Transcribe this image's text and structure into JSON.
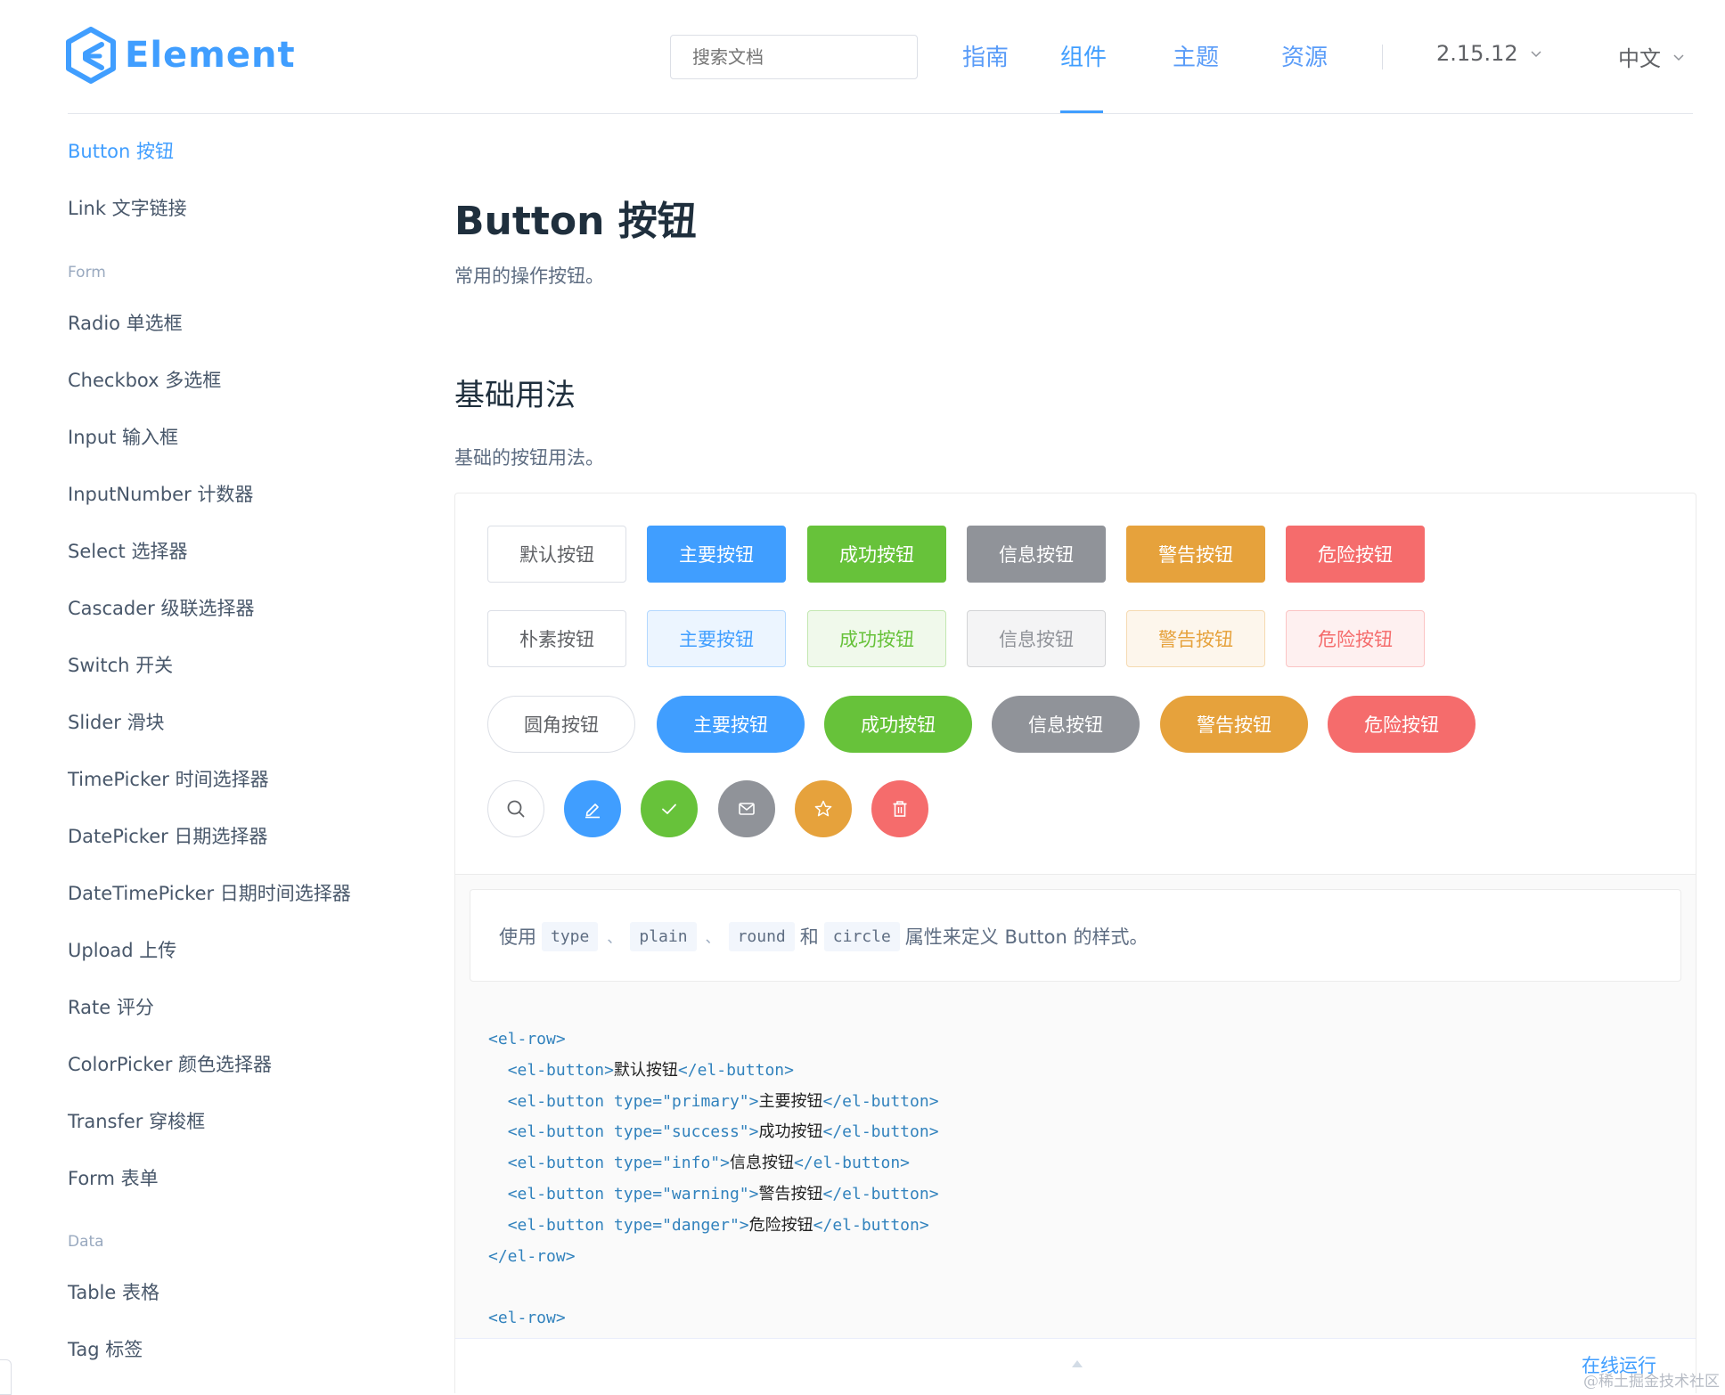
{
  "header": {
    "logo_text": "Element",
    "search_placeholder": "搜索文档",
    "nav": [
      {
        "label": "指南",
        "active": false
      },
      {
        "label": "组件",
        "active": true
      },
      {
        "label": "主题",
        "active": false
      },
      {
        "label": "资源",
        "active": false
      }
    ],
    "version": "2.15.12",
    "language": "中文"
  },
  "sidebar": {
    "items": [
      {
        "label": "Button 按钮",
        "active": true
      },
      {
        "label": "Link 文字链接"
      }
    ],
    "groups": [
      {
        "title": "Form",
        "items": [
          "Radio 单选框",
          "Checkbox 多选框",
          "Input 输入框",
          "InputNumber 计数器",
          "Select 选择器",
          "Cascader 级联选择器",
          "Switch 开关",
          "Slider 滑块",
          "TimePicker 时间选择器",
          "DatePicker 日期选择器",
          "DateTimePicker 日期时间选择器",
          "Upload 上传",
          "Rate 评分",
          "ColorPicker 颜色选择器",
          "Transfer 穿梭框",
          "Form 表单"
        ]
      },
      {
        "title": "Data",
        "items": [
          "Table 表格",
          "Tag 标签"
        ]
      }
    ]
  },
  "main": {
    "title": "Button 按钮",
    "description": "常用的操作按钮。",
    "section_title": "基础用法",
    "section_desc": "基础的按钮用法。",
    "rows": {
      "basic": [
        "默认按钮",
        "主要按钮",
        "成功按钮",
        "信息按钮",
        "警告按钮",
        "危险按钮"
      ],
      "plain": [
        "朴素按钮",
        "主要按钮",
        "成功按钮",
        "信息按钮",
        "警告按钮",
        "危险按钮"
      ],
      "round": [
        "圆角按钮",
        "主要按钮",
        "成功按钮",
        "信息按钮",
        "警告按钮",
        "危险按钮"
      ],
      "circle_icons": [
        "search-icon",
        "edit-icon",
        "check-icon",
        "message-icon",
        "star-icon",
        "delete-icon"
      ]
    },
    "meta": {
      "prefix": "使用",
      "codes": [
        "type",
        "plain",
        "round",
        "circle"
      ],
      "separator": "、",
      "conjunction": "和",
      "suffix": "属性来定义 Button 的样式。"
    },
    "code_lines": [
      {
        "indent": "",
        "open": "<el-row>",
        "attr": "",
        "value": "",
        "text": "",
        "close": ""
      },
      {
        "indent": "  ",
        "open": "<el-button",
        "attr": "",
        "value": "",
        "text": "默认按钮",
        "close": "</el-button>"
      },
      {
        "indent": "  ",
        "open": "<el-button",
        "attr": " type=",
        "value": "\"primary\"",
        "text": "主要按钮",
        "close": "</el-button>"
      },
      {
        "indent": "  ",
        "open": "<el-button",
        "attr": " type=",
        "value": "\"success\"",
        "text": "成功按钮",
        "close": "</el-button>"
      },
      {
        "indent": "  ",
        "open": "<el-button",
        "attr": " type=",
        "value": "\"info\"",
        "text": "信息按钮",
        "close": "</el-button>"
      },
      {
        "indent": "  ",
        "open": "<el-button",
        "attr": " type=",
        "value": "\"warning\"",
        "text": "警告按钮",
        "close": "</el-button>"
      },
      {
        "indent": "  ",
        "open": "<el-button",
        "attr": " type=",
        "value": "\"danger\"",
        "text": "危险按钮",
        "close": "</el-button>"
      },
      {
        "indent": "",
        "open": "</el-row>",
        "attr": "",
        "value": "",
        "text": "",
        "close": ""
      },
      {
        "indent": "",
        "open": "",
        "attr": "",
        "value": "",
        "text": "",
        "close": ""
      },
      {
        "indent": "",
        "open": "<el-row>",
        "attr": "",
        "value": "",
        "text": "",
        "close": ""
      }
    ],
    "run_online": "在线运行"
  },
  "watermark": "@稀土掘金技术社区",
  "colors": {
    "primary": "#409EFF",
    "success": "#67C23A",
    "info": "#909399",
    "warning": "#E6A23C",
    "danger": "#F56C6C"
  }
}
